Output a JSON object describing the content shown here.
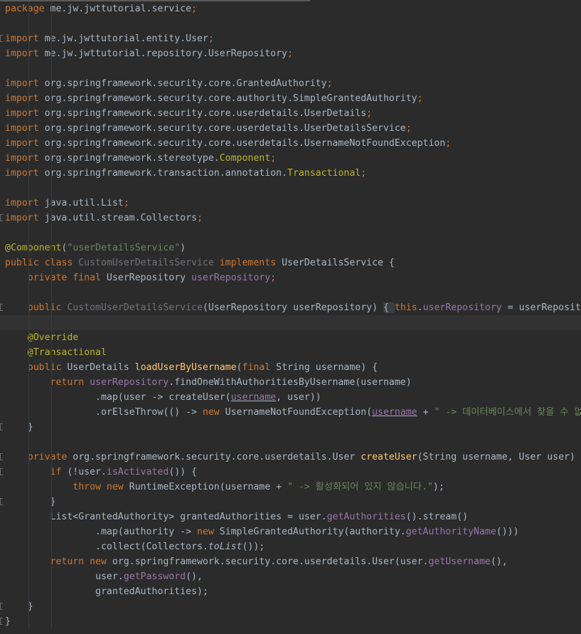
{
  "editor": {
    "lines": [
      {
        "current": false,
        "fold": false,
        "tokens": [
          {
            "text": "package ",
            "cls": "t-kw"
          },
          {
            "text": "me.jw.jwttutorial.service",
            "cls": "t-plain"
          },
          {
            "text": ";",
            "cls": "t-kw"
          }
        ]
      },
      {
        "current": false,
        "fold": false,
        "tokens": []
      },
      {
        "current": false,
        "fold": true,
        "tokens": [
          {
            "text": "import ",
            "cls": "t-kw"
          },
          {
            "text": "me.jw.jwttutorial.entity.User",
            "cls": "t-plain"
          },
          {
            "text": ";",
            "cls": "t-kw"
          }
        ]
      },
      {
        "current": false,
        "fold": false,
        "tokens": [
          {
            "text": "import ",
            "cls": "t-kw"
          },
          {
            "text": "me.jw.jwttutorial.repository.UserRepository",
            "cls": "t-plain"
          },
          {
            "text": ";",
            "cls": "t-kw"
          }
        ]
      },
      {
        "current": false,
        "fold": false,
        "tokens": []
      },
      {
        "current": false,
        "fold": false,
        "tokens": [
          {
            "text": "import ",
            "cls": "t-kw"
          },
          {
            "text": "org.springframework.security.core.GrantedAuthority",
            "cls": "t-plain"
          },
          {
            "text": ";",
            "cls": "t-kw"
          }
        ]
      },
      {
        "current": false,
        "fold": false,
        "tokens": [
          {
            "text": "import ",
            "cls": "t-kw"
          },
          {
            "text": "org.springframework.security.core.authority.SimpleGrantedAuthority",
            "cls": "t-plain"
          },
          {
            "text": ";",
            "cls": "t-kw"
          }
        ]
      },
      {
        "current": false,
        "fold": false,
        "tokens": [
          {
            "text": "import ",
            "cls": "t-kw"
          },
          {
            "text": "org.springframework.security.core.userdetails.UserDetails",
            "cls": "t-plain"
          },
          {
            "text": ";",
            "cls": "t-kw"
          }
        ]
      },
      {
        "current": false,
        "fold": false,
        "tokens": [
          {
            "text": "import ",
            "cls": "t-kw"
          },
          {
            "text": "org.springframework.security.core.userdetails.UserDetailsService",
            "cls": "t-plain"
          },
          {
            "text": ";",
            "cls": "t-kw"
          }
        ]
      },
      {
        "current": false,
        "fold": false,
        "tokens": [
          {
            "text": "import ",
            "cls": "t-kw"
          },
          {
            "text": "org.springframework.security.core.userdetails.UsernameNotFoundException",
            "cls": "t-plain"
          },
          {
            "text": ";",
            "cls": "t-kw"
          }
        ]
      },
      {
        "current": false,
        "fold": false,
        "tokens": [
          {
            "text": "import ",
            "cls": "t-kw"
          },
          {
            "text": "org.springframework.stereotype.",
            "cls": "t-plain"
          },
          {
            "text": "Component",
            "cls": "t-ann"
          },
          {
            "text": ";",
            "cls": "t-kw"
          }
        ]
      },
      {
        "current": false,
        "fold": false,
        "tokens": [
          {
            "text": "import ",
            "cls": "t-kw"
          },
          {
            "text": "org.springframework.transaction.annotation.",
            "cls": "t-plain"
          },
          {
            "text": "Transactional",
            "cls": "t-ann"
          },
          {
            "text": ";",
            "cls": "t-kw"
          }
        ]
      },
      {
        "current": false,
        "fold": false,
        "tokens": []
      },
      {
        "current": false,
        "fold": false,
        "tokens": [
          {
            "text": "import ",
            "cls": "t-kw"
          },
          {
            "text": "java.util.List",
            "cls": "t-plain"
          },
          {
            "text": ";",
            "cls": "t-kw"
          }
        ]
      },
      {
        "current": false,
        "fold": true,
        "tokens": [
          {
            "text": "import ",
            "cls": "t-kw"
          },
          {
            "text": "java.util.stream.Collectors",
            "cls": "t-plain"
          },
          {
            "text": ";",
            "cls": "t-kw"
          }
        ]
      },
      {
        "current": false,
        "fold": false,
        "tokens": []
      },
      {
        "current": false,
        "fold": false,
        "tokens": [
          {
            "text": "@Component",
            "cls": "t-ann"
          },
          {
            "text": "(",
            "cls": "t-plain"
          },
          {
            "text": "\"userDetailsService\"",
            "cls": "t-str"
          },
          {
            "text": ")",
            "cls": "t-plain"
          }
        ]
      },
      {
        "current": false,
        "fold": false,
        "tokens": [
          {
            "text": "public class ",
            "cls": "t-kw"
          },
          {
            "text": "CustomUserDetailsService ",
            "cls": "t-unused"
          },
          {
            "text": "implements ",
            "cls": "t-kw"
          },
          {
            "text": "UserDetailsService {",
            "cls": "t-plain"
          }
        ]
      },
      {
        "current": false,
        "fold": false,
        "tokens": [
          {
            "text": "    private final ",
            "cls": "t-kw"
          },
          {
            "text": "UserRepository ",
            "cls": "t-plain"
          },
          {
            "text": "userRepository",
            "cls": "t-field"
          },
          {
            "text": ";",
            "cls": "t-kw"
          }
        ]
      },
      {
        "current": false,
        "fold": false,
        "tokens": []
      },
      {
        "current": false,
        "fold": true,
        "tokens": [
          {
            "text": "    public ",
            "cls": "t-kw"
          },
          {
            "text": "CustomUserDetailsService",
            "cls": "t-unused"
          },
          {
            "text": "(UserRepository userRepository) ",
            "cls": "t-plain"
          },
          {
            "text": "{ ",
            "cls": "t-fold"
          },
          {
            "text": "this",
            "cls": "t-kw"
          },
          {
            "text": ".",
            "cls": "t-plain"
          },
          {
            "text": "userRepository",
            "cls": "t-field"
          },
          {
            "text": " = userRepository; }",
            "cls": "t-plain"
          }
        ]
      },
      {
        "current": true,
        "fold": false,
        "tokens": []
      },
      {
        "current": false,
        "fold": false,
        "tokens": [
          {
            "text": "    @Override",
            "cls": "t-ann"
          }
        ]
      },
      {
        "current": false,
        "fold": false,
        "tokens": [
          {
            "text": "    @Transactional",
            "cls": "t-ann"
          }
        ]
      },
      {
        "current": false,
        "fold": false,
        "tokens": [
          {
            "text": "    public ",
            "cls": "t-kw"
          },
          {
            "text": "UserDetails ",
            "cls": "t-plain"
          },
          {
            "text": "loadUserByUsername",
            "cls": "t-fn"
          },
          {
            "text": "(",
            "cls": "t-plain"
          },
          {
            "text": "final ",
            "cls": "t-kw"
          },
          {
            "text": "String username) {",
            "cls": "t-plain"
          }
        ]
      },
      {
        "current": false,
        "fold": false,
        "tokens": [
          {
            "text": "        return ",
            "cls": "t-kw"
          },
          {
            "text": "userRepository",
            "cls": "t-field"
          },
          {
            "text": ".findOneWithAuthoritiesByUsername(username)",
            "cls": "t-plain"
          }
        ]
      },
      {
        "current": false,
        "fold": false,
        "tokens": [
          {
            "text": "                .map(user -> createUser(",
            "cls": "t-plain"
          },
          {
            "text": "username",
            "cls": "t-field t-under"
          },
          {
            "text": ", user))",
            "cls": "t-plain"
          }
        ]
      },
      {
        "current": false,
        "fold": false,
        "tokens": [
          {
            "text": "                .orElseThrow(() -> ",
            "cls": "t-plain"
          },
          {
            "text": "new ",
            "cls": "t-kw"
          },
          {
            "text": "UsernameNotFoundException(",
            "cls": "t-plain"
          },
          {
            "text": "username",
            "cls": "t-field t-under"
          },
          {
            "text": " + ",
            "cls": "t-plain"
          },
          {
            "text": "\" -> 데이터베이스에서 찾을 수 없습니다.\"",
            "cls": "t-str"
          },
          {
            "text": "));",
            "cls": "t-plain"
          }
        ]
      },
      {
        "current": false,
        "fold": true,
        "tokens": [
          {
            "text": "    }",
            "cls": "t-plain"
          }
        ]
      },
      {
        "current": false,
        "fold": false,
        "tokens": []
      },
      {
        "current": false,
        "fold": true,
        "tokens": [
          {
            "text": "    private ",
            "cls": "t-kw"
          },
          {
            "text": "org.springframework.security.core.userdetails.User ",
            "cls": "t-plain"
          },
          {
            "text": "createUser",
            "cls": "t-fn"
          },
          {
            "text": "(String username, User user) {",
            "cls": "t-plain"
          }
        ]
      },
      {
        "current": false,
        "fold": true,
        "tokens": [
          {
            "text": "        if ",
            "cls": "t-kw"
          },
          {
            "text": "(!user.",
            "cls": "t-plain"
          },
          {
            "text": "isActivated",
            "cls": "t-field"
          },
          {
            "text": "()) {",
            "cls": "t-plain"
          }
        ]
      },
      {
        "current": false,
        "fold": false,
        "tokens": [
          {
            "text": "            throw new ",
            "cls": "t-kw"
          },
          {
            "text": "RuntimeException(username + ",
            "cls": "t-plain"
          },
          {
            "text": "\" -> 활성화되어 있지 않습니다.\"",
            "cls": "t-str"
          },
          {
            "text": ");",
            "cls": "t-plain"
          }
        ]
      },
      {
        "current": false,
        "fold": true,
        "tokens": [
          {
            "text": "        }",
            "cls": "t-plain"
          }
        ]
      },
      {
        "current": false,
        "fold": false,
        "tokens": [
          {
            "text": "        List<GrantedAuthority> grantedAuthorities = user.",
            "cls": "t-plain"
          },
          {
            "text": "getAuthorities",
            "cls": "t-field"
          },
          {
            "text": "().stream()",
            "cls": "t-plain"
          }
        ]
      },
      {
        "current": false,
        "fold": false,
        "tokens": [
          {
            "text": "                .map(authority -> ",
            "cls": "t-plain"
          },
          {
            "text": "new ",
            "cls": "t-kw"
          },
          {
            "text": "SimpleGrantedAuthority(authority.",
            "cls": "t-plain"
          },
          {
            "text": "getAuthorityName",
            "cls": "t-field"
          },
          {
            "text": "()))",
            "cls": "t-plain"
          }
        ]
      },
      {
        "current": false,
        "fold": false,
        "tokens": [
          {
            "text": "                .collect(Collectors.",
            "cls": "t-plain"
          },
          {
            "text": "toList",
            "cls": "t-plain t-italic"
          },
          {
            "text": "());",
            "cls": "t-plain"
          }
        ]
      },
      {
        "current": false,
        "fold": false,
        "tokens": [
          {
            "text": "        return new ",
            "cls": "t-kw"
          },
          {
            "text": "org.springframework.security.core.userdetails.User(user.",
            "cls": "t-plain"
          },
          {
            "text": "getUsername",
            "cls": "t-field"
          },
          {
            "text": "(),",
            "cls": "t-plain"
          }
        ]
      },
      {
        "current": false,
        "fold": false,
        "tokens": [
          {
            "text": "                user.",
            "cls": "t-plain"
          },
          {
            "text": "getPassword",
            "cls": "t-field"
          },
          {
            "text": "(),",
            "cls": "t-plain"
          }
        ]
      },
      {
        "current": false,
        "fold": false,
        "tokens": [
          {
            "text": "                grantedAuthorities);",
            "cls": "t-plain"
          }
        ]
      },
      {
        "current": false,
        "fold": true,
        "tokens": [
          {
            "text": "    }",
            "cls": "t-plain"
          }
        ]
      },
      {
        "current": false,
        "fold": true,
        "tokens": [
          {
            "text": "}",
            "cls": "t-plain"
          }
        ]
      }
    ]
  }
}
